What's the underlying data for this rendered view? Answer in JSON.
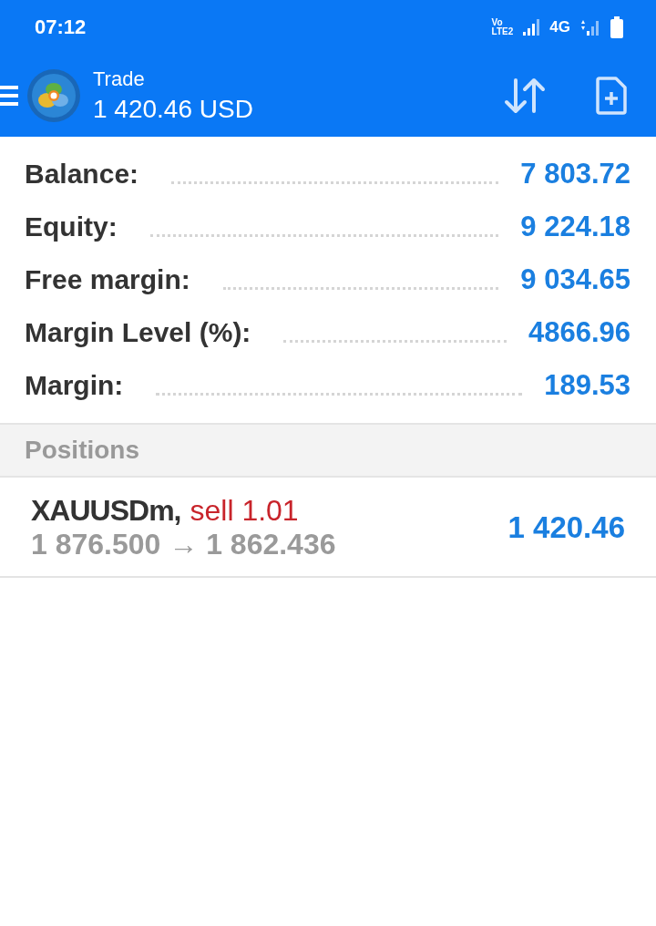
{
  "status_bar": {
    "time": "07:12",
    "volte_top": "Vo",
    "volte_bottom": "LTE2",
    "network": "4G"
  },
  "app_bar": {
    "title": "Trade",
    "subtitle": "1 420.46 USD"
  },
  "summary": [
    {
      "label": "Balance:",
      "value": "7 803.72"
    },
    {
      "label": "Equity:",
      "value": "9 224.18"
    },
    {
      "label": "Free margin:",
      "value": "9 034.65"
    },
    {
      "label": "Margin Level (%):",
      "value": "4866.96"
    },
    {
      "label": "Margin:",
      "value": "189.53"
    }
  ],
  "positions": {
    "header": "Positions",
    "items": [
      {
        "symbol": "XAUUSDm,",
        "kind": "sell",
        "order": "sell 1.01",
        "prices": "1 876.500 → 1 862.436",
        "profit": "1 420.46"
      }
    ]
  }
}
